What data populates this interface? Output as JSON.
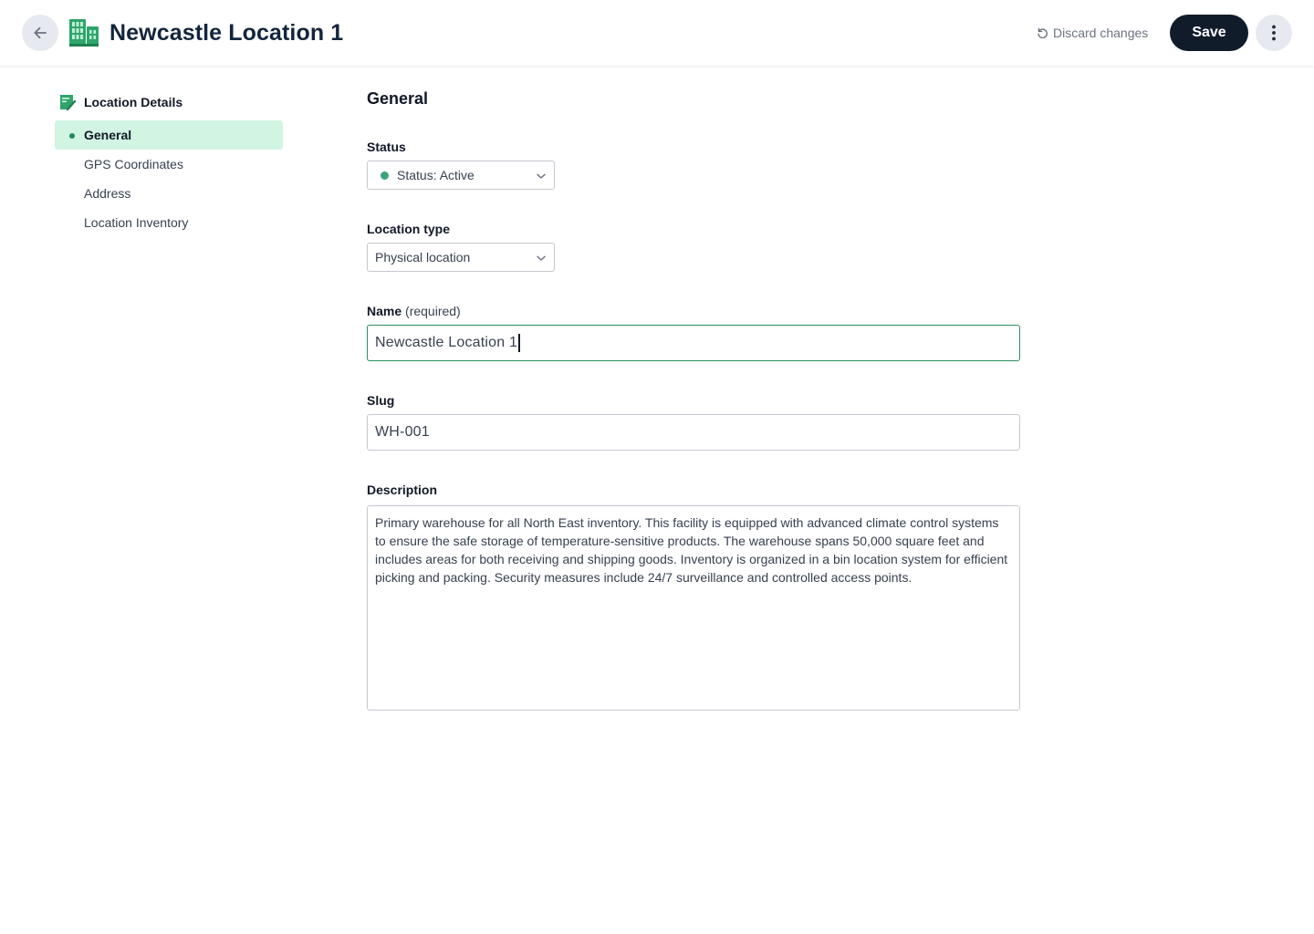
{
  "header": {
    "title": "Newcastle Location 1",
    "discard_label": "Discard changes",
    "save_label": "Save"
  },
  "icons": {
    "back": "arrow-left-icon",
    "title": "building-icon",
    "discard": "undo-icon",
    "more": "more-vertical-icon",
    "section": "form-icon",
    "dropdown": "chevron-down-icon"
  },
  "colors": {
    "accent": "#2b8f61",
    "active_nav_bg": "#d2f4e3",
    "save_bg": "#111c2b",
    "status_active": "#3ba47b"
  },
  "sidebar": {
    "heading": "Location Details",
    "items": [
      {
        "label": "General",
        "active": true
      },
      {
        "label": "GPS Coordinates",
        "active": false
      },
      {
        "label": "Address",
        "active": false
      },
      {
        "label": "Location Inventory",
        "active": false
      }
    ]
  },
  "form": {
    "section_title": "General",
    "status": {
      "label": "Status",
      "value": "Status: Active"
    },
    "location_type": {
      "label": "Location type",
      "value": "Physical location"
    },
    "name": {
      "label": "Name",
      "hint": "(required)",
      "value": "Newcastle Location 1"
    },
    "slug": {
      "label": "Slug",
      "value": "WH-001"
    },
    "description": {
      "label": "Description",
      "value": "Primary warehouse for all North East inventory. This facility is equipped with advanced climate control systems to ensure the safe storage of temperature-sensitive products. The warehouse spans 50,000 square feet and includes areas for both receiving and shipping goods. Inventory is organized in a bin location system for efficient picking and packing. Security measures include 24/7 surveillance and controlled access points."
    }
  }
}
